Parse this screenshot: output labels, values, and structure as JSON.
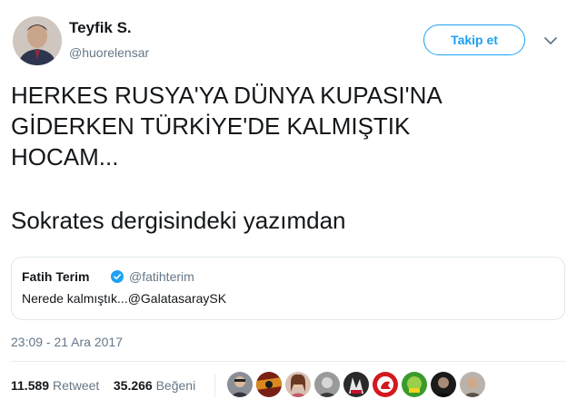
{
  "author": {
    "name": "Teyfik S.",
    "handle": "@huorelensar",
    "follow_label": "Takip et"
  },
  "tweet": {
    "text_main": "HERKES RUSYA'YA DÜNYA KUPASI'NA\nGİDERKEN TÜRKİYE'DE KALMIŞTIK\nHOCAM...",
    "text_sub": "Sokrates dergisindeki yazımdan"
  },
  "quoted": {
    "name": "Fatih Terim",
    "handle": "@fatihterim",
    "text": "Nerede kalmıştık...@GalatasaraySK"
  },
  "timestamp": "23:09 - 21 Ara 2017",
  "stats": {
    "retweet_count": "11.589",
    "retweet_label": "Retweet",
    "like_count": "35.266",
    "like_label": "Beğeni"
  },
  "colors": {
    "accent": "#1da1f2",
    "secondary_text": "#657786"
  },
  "icons": [
    "chevron-down-icon",
    "verified-badge-icon"
  ]
}
